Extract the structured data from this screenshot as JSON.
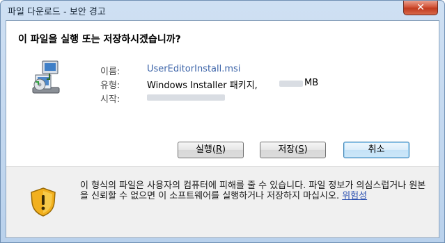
{
  "window": {
    "title": "파일 다운로드 - 보안 경고",
    "close_glyph": "✕"
  },
  "dialog": {
    "question": "이 파일을 실행 또는 저장하시겠습니까?",
    "icon": "msi-installer-icon",
    "fields": {
      "name_label": "이름:",
      "name_value": "UserEditorInstall.msi",
      "type_label": "유형:",
      "type_value": "Windows Installer 패키지,",
      "type_size_unit": "MB",
      "from_label": "시작:"
    },
    "buttons": {
      "run_prefix": "실행(",
      "run_key": "R",
      "save_prefix": "저장(",
      "save_key": "S",
      "close_paren": ")",
      "cancel": "취소"
    },
    "warning": {
      "icon": "warning-shield-icon",
      "text": "이 형식의 파일은 사용자의 컴퓨터에 피해를 줄 수 있습니다. 파일 정보가 의심스럽거나 원본을 신뢰할 수 없으면 이 소프트웨어를 실행하거나 저장하지 마십시오. ",
      "link": "위험성"
    }
  },
  "colors": {
    "title_bar": "#c4d9f0",
    "close_button": "#c9452a",
    "link": "#3b63a8",
    "default_button_border": "#3c7fb1"
  }
}
